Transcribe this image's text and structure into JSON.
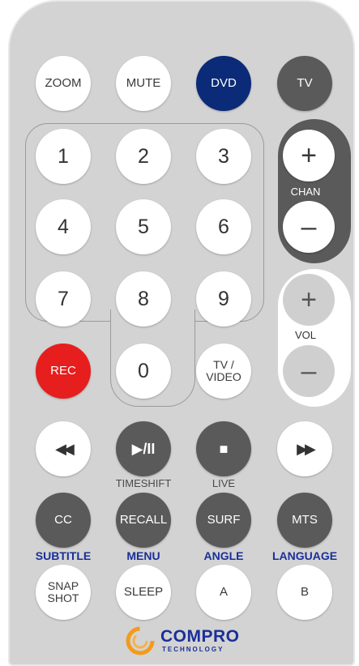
{
  "top_row": {
    "zoom": "ZOOM",
    "mute": "MUTE",
    "dvd": "DVD",
    "tv": "TV"
  },
  "keypad": [
    "1",
    "2",
    "3",
    "4",
    "5",
    "6",
    "7",
    "8",
    "9",
    "0"
  ],
  "chan": {
    "plus": "+",
    "label": "CHAN",
    "minus": "–"
  },
  "vol": {
    "plus": "+",
    "label": "VOL",
    "minus": "–"
  },
  "rec": "REC",
  "tv_video": "TV /\nVIDEO",
  "transport": {
    "rewind": "◀◀",
    "play_pause": "▶/II",
    "stop": "■",
    "forward": "▶▶"
  },
  "transport_labels": {
    "timeshift": "TIMESHIFT",
    "live": "LIVE"
  },
  "function_row": {
    "cc": "CC",
    "recall": "RECALL",
    "surf": "SURF",
    "mts": "MTS"
  },
  "function_labels": {
    "subtitle": "SUBTITLE",
    "menu": "MENU",
    "angle": "ANGLE",
    "language": "LANGUAGE"
  },
  "bottom_row": {
    "snapshot": "SNAP\nSHOT",
    "sleep": "SLEEP",
    "a": "A",
    "b": "B"
  },
  "logo": {
    "brand": "COMPRO",
    "sub": "TECHNOLOGY"
  },
  "colors": {
    "body": "#d3d3d3",
    "dark": "#5a5a5a",
    "navy": "#0b2a78",
    "rec": "#e61e1e",
    "label_blue": "#1a2f99",
    "logo_orange": "#f39a1e"
  }
}
